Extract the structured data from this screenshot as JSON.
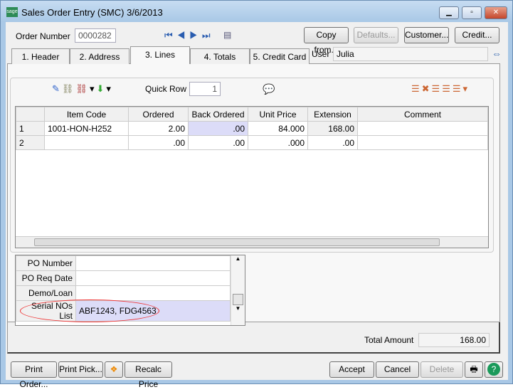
{
  "window": {
    "title": "Sales Order Entry (SMC) 3/6/2013",
    "logo": "sage"
  },
  "header": {
    "order_number_label": "Order Number",
    "order_number": "0000282",
    "copy_from": "Copy from...",
    "defaults": "Defaults...",
    "customer": "Customer...",
    "credit": "Credit...",
    "user_label": "User",
    "user": "Julia"
  },
  "tabs": [
    {
      "label": "1. Header"
    },
    {
      "label": "2. Address"
    },
    {
      "label": "3. Lines"
    },
    {
      "label": "4. Totals"
    },
    {
      "label": "5. Credit Card"
    }
  ],
  "toolbar": {
    "quick_row_label": "Quick Row",
    "quick_row_value": "1"
  },
  "grid": {
    "columns": [
      "",
      "Item Code",
      "Ordered",
      "Back Ordered",
      "Unit Price",
      "Extension",
      "Comment"
    ],
    "rows": [
      [
        "1",
        "1001-HON-H252",
        "2.00",
        ".00",
        "84.000",
        "168.00",
        ""
      ],
      [
        "2",
        "",
        ".00",
        ".00",
        ".000",
        ".00",
        ""
      ]
    ]
  },
  "udf": [
    {
      "label": "PO Number",
      "value": ""
    },
    {
      "label": "PO Req Date",
      "value": ""
    },
    {
      "label": "Demo/Loan",
      "value": ""
    },
    {
      "label": "Serial NOs List",
      "value": "ABF1243, FDG4563"
    }
  ],
  "totals": {
    "label": "Total Amount",
    "value": "168.00"
  },
  "footer": {
    "print_order": "Print Order...",
    "print_pick": "Print Pick...",
    "recalc": "Recalc Price",
    "accept": "Accept",
    "cancel": "Cancel",
    "delete": "Delete"
  }
}
